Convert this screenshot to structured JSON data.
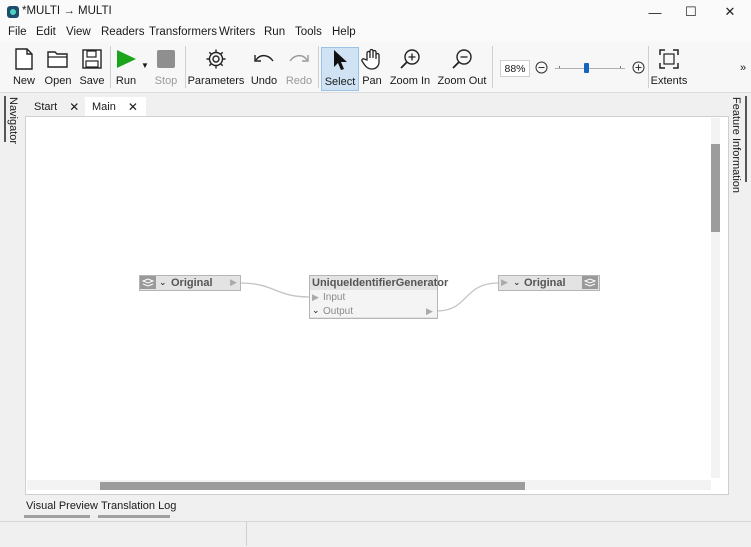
{
  "window": {
    "title": "*MULTI → MULTI",
    "controls": {
      "minimize": "—",
      "maximize": "☐",
      "close": "✕"
    }
  },
  "menu": [
    "File",
    "Edit",
    "View",
    "Readers",
    "Transformers",
    "Writers",
    "Run",
    "Tools",
    "Help"
  ],
  "toolbar": {
    "new": "New",
    "open": "Open",
    "save": "Save",
    "run": "Run",
    "stop": "Stop",
    "parameters": "Parameters",
    "undo": "Undo",
    "redo": "Redo",
    "select": "Select",
    "pan": "Pan",
    "zoom_in": "Zoom In",
    "zoom_out": "Zoom Out",
    "zoom_level": "88%",
    "extents": "Extents",
    "overflow": "»"
  },
  "side_panels": {
    "left": "Navigator",
    "right": "Feature Information"
  },
  "tabs": [
    {
      "label": "Start"
    },
    {
      "label": "Main"
    }
  ],
  "canvas": {
    "reader": {
      "label": "Original"
    },
    "transformer": {
      "title": "UniqueIdentifierGenerator",
      "input": "Input",
      "output": "Output"
    },
    "writer": {
      "label": "Original"
    }
  },
  "bottom_tabs": [
    "Visual Preview",
    "Translation Log"
  ],
  "colors": {
    "run_green": "#1aa51a",
    "accent_blue": "#1565c0",
    "node_gray": "#e3e3e3"
  }
}
